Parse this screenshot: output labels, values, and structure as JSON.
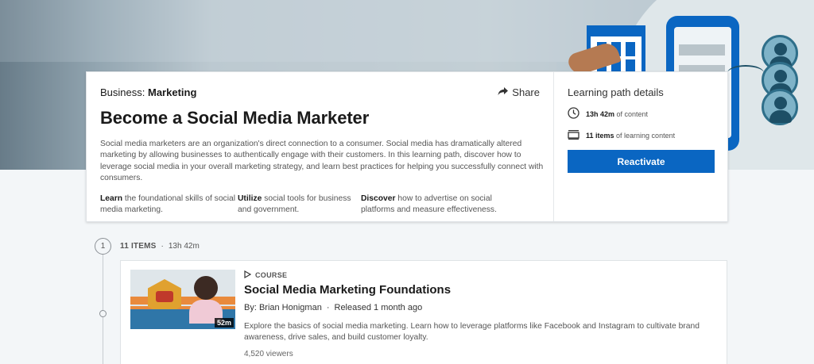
{
  "hero": {
    "colors": {
      "accent": "#0a66c2",
      "banner_dark": "#1f3a4c",
      "banner_light": "#c6d2d8"
    }
  },
  "path": {
    "category_prefix": "Business: ",
    "category_name": "Marketing",
    "share_label": "Share",
    "title": "Become a Social Media Marketer",
    "description": "Social media marketers are an organization's direct connection to a consumer. Social media has dramatically altered marketing by allowing businesses to authentically engage with their customers. In this learning path, discover how to leverage social media in your overall marketing strategy, and learn best practices for helping you successfully connect with consumers.",
    "points": [
      {
        "keyword": "Learn",
        "rest": " the foundational skills of social media marketing."
      },
      {
        "keyword": "Utilize",
        "rest": " social tools for business and government."
      },
      {
        "keyword": "Discover",
        "rest": " how to advertise on social platforms and measure effectiveness."
      }
    ]
  },
  "details": {
    "title": "Learning path details",
    "duration_value": "13h 42m",
    "duration_suffix": " of content",
    "items_value": "11 items",
    "items_suffix": " of learning content",
    "reactivate_label": "Reactivate"
  },
  "timeline": {
    "step_number": "1",
    "items_count": "11 ITEMS",
    "separator": "·",
    "total_duration": "13h 42m"
  },
  "course": {
    "type_label": "COURSE",
    "title": "Social Media Marketing Foundations",
    "author": "By: Brian Honigman",
    "separator": "·",
    "released": "Released 1 month ago",
    "description": "Explore the basics of social media marketing. Learn how to leverage platforms like Facebook and Instagram to cultivate brand awareness, drive sales, and build customer loyalty.",
    "viewers": "4,520 viewers",
    "duration_badge": "52m"
  }
}
